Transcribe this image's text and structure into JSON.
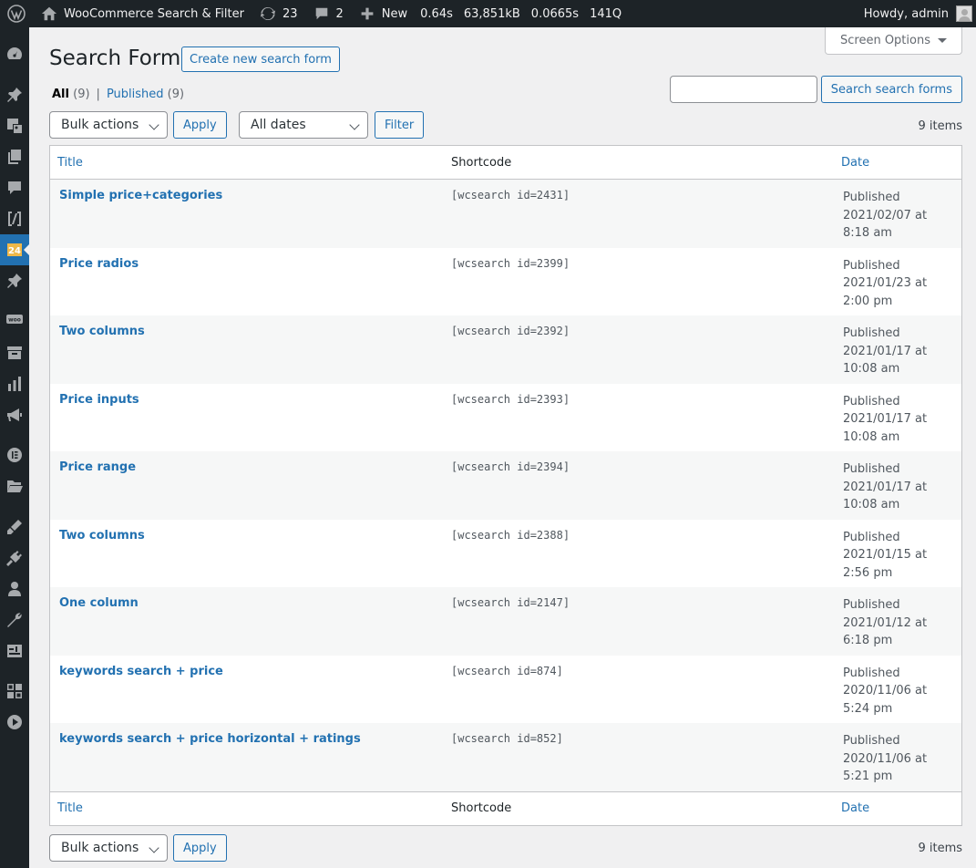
{
  "adminbar": {
    "site_name": "WooCommerce Search & Filter",
    "updates_count": "23",
    "comments_count": "2",
    "new_label": "New",
    "qm_time": "0.64s",
    "qm_memory": "63,851kB",
    "qm_db_time": "0.0665s",
    "qm_queries": "141Q",
    "howdy": "Howdy, admin"
  },
  "screen_options": "Screen Options",
  "page": {
    "title": "Search Forms",
    "add_new": "Create new search form"
  },
  "views": {
    "all_label": "All",
    "all_count": "(9)",
    "separator": "|",
    "published_label": "Published",
    "published_count": "(9)"
  },
  "search": {
    "button": "Search search forms"
  },
  "tablenav_top": {
    "bulk_actions": "Bulk actions",
    "apply": "Apply",
    "all_dates": "All dates",
    "filter": "Filter",
    "items": "9 items"
  },
  "tablenav_bottom": {
    "bulk_actions": "Bulk actions",
    "apply": "Apply",
    "items": "9 items"
  },
  "columns": {
    "title": "Title",
    "shortcode": "Shortcode",
    "date": "Date"
  },
  "rows": [
    {
      "title": "Simple price+categories",
      "shortcode": "[wcsearch id=2431]",
      "status": "Published",
      "date": "2021/02/07 at 8:18 am"
    },
    {
      "title": "Price radios",
      "shortcode": "[wcsearch id=2399]",
      "status": "Published",
      "date": "2021/01/23 at 2:00 pm"
    },
    {
      "title": "Two columns",
      "shortcode": "[wcsearch id=2392]",
      "status": "Published",
      "date": "2021/01/17 at 10:08 am"
    },
    {
      "title": "Price inputs",
      "shortcode": "[wcsearch id=2393]",
      "status": "Published",
      "date": "2021/01/17 at 10:08 am"
    },
    {
      "title": "Price range",
      "shortcode": "[wcsearch id=2394]",
      "status": "Published",
      "date": "2021/01/17 at 10:08 am"
    },
    {
      "title": "Two columns",
      "shortcode": "[wcsearch id=2388]",
      "status": "Published",
      "date": "2021/01/15 at 2:56 pm"
    },
    {
      "title": "One column",
      "shortcode": "[wcsearch id=2147]",
      "status": "Published",
      "date": "2021/01/12 at 6:18 pm"
    },
    {
      "title": "keywords search + price",
      "shortcode": "[wcsearch id=874]",
      "status": "Published",
      "date": "2020/11/06 at 5:24 pm"
    },
    {
      "title": "keywords search + price horizontal + ratings",
      "shortcode": "[wcsearch id=852]",
      "status": "Published",
      "date": "2020/11/06 at 5:21 pm"
    }
  ],
  "sidebar_icons": [
    "dashboard-icon",
    "pin-icon",
    "media-icon",
    "pages-icon",
    "comments-icon",
    "shortcode-icon",
    "plugin-24-icon",
    "pin-icon",
    "woo-icon",
    "archive-icon",
    "analytics-icon",
    "marketing-icon",
    "elementor-icon",
    "folder-icon",
    "appearance-icon",
    "plugins-icon",
    "users-icon",
    "tools-icon",
    "settings-icon",
    "grid-icon",
    "play-icon"
  ]
}
